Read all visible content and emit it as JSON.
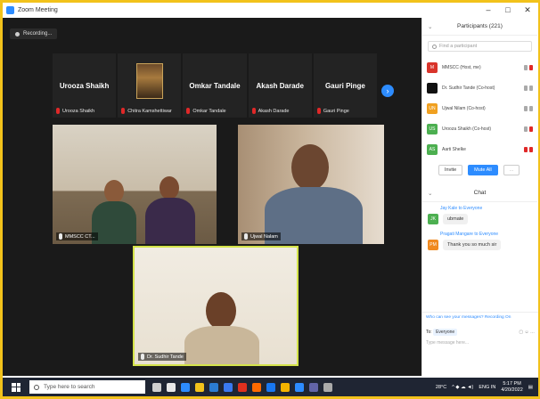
{
  "window": {
    "title": "Zoom Meeting",
    "controls": [
      "–",
      "□",
      "✕"
    ]
  },
  "recording": {
    "label": "Recording..."
  },
  "strip": [
    {
      "name": "Urooza Shaikh",
      "caption": "Urooza Shaikh",
      "muted": true
    },
    {
      "name": "",
      "caption": "Chitra Kamshettiwar",
      "muted": true,
      "has_photo": true
    },
    {
      "name": "Omkar Tandale",
      "caption": "Omkar Tandale",
      "muted": true
    },
    {
      "name": "Akash Darade",
      "caption": "Akash Darade",
      "muted": true
    },
    {
      "name": "Gauri Pinge",
      "caption": "Gauri Pinge",
      "muted": true
    }
  ],
  "videos": [
    {
      "caption": "MMSCC CT...",
      "muted": false
    },
    {
      "caption": "Ujwal Nalam",
      "muted": false
    },
    {
      "caption": "Dr. Sudhir Tande",
      "muted": false
    }
  ],
  "participants_panel": {
    "title": "Participants (221)",
    "search_placeholder": "Find a participant",
    "items": [
      {
        "initials": "M",
        "name": "MMSCC (Host, me)",
        "color": "#d9342b"
      },
      {
        "initials": "",
        "name": "Dr. Sudhir Tande (Co-host)",
        "color": "#111111"
      },
      {
        "initials": "UN",
        "name": "Ujwal Nilam (Co-host)",
        "color": "#f0a020"
      },
      {
        "initials": "US",
        "name": "Urooza Shaikh (Co-host)",
        "color": "#4caf50"
      },
      {
        "initials": "AS",
        "name": "Aarti Shelke",
        "color": "#4caf50"
      }
    ],
    "buttons": {
      "invite": "Invite",
      "mute_all": "Mute All",
      "more": "..."
    }
  },
  "chat": {
    "title": "Chat",
    "messages": [
      {
        "from": "Jay Kale to Everyone",
        "text": "ubmate",
        "initials": "JK",
        "color": "#4caf50"
      },
      {
        "from": "Pragati Mangare to Everyone",
        "text": "Thank you so much sir",
        "initials": "PM",
        "color": "#f08a20"
      }
    ],
    "notice": "Who can see your messages? Recording On",
    "to_label": "To:",
    "to_value": "Everyone",
    "input_placeholder": "Type message here..."
  },
  "taskbar": {
    "search_placeholder": "Type here to search",
    "weather": "28°C",
    "lang": "ENG IN",
    "time": "5:17 PM",
    "date": "4/20/2022"
  }
}
